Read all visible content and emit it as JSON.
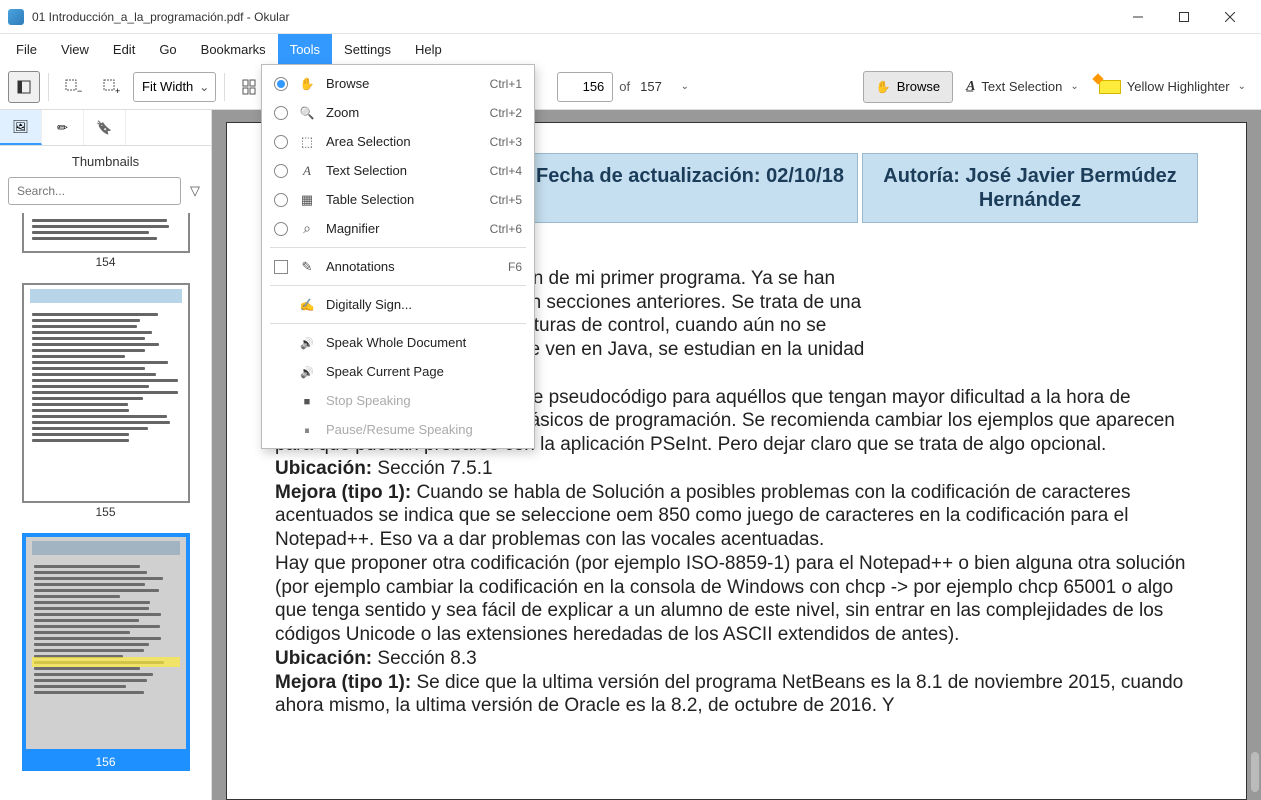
{
  "window": {
    "title": "01 Introducción_a_la_programación.pdf - Okular"
  },
  "menubar": {
    "items": [
      "File",
      "View",
      "Edit",
      "Go",
      "Bookmarks",
      "Tools",
      "Settings",
      "Help"
    ],
    "active_index": 5
  },
  "tools_menu": {
    "items": [
      {
        "type": "radio",
        "checked": true,
        "icon": "hand",
        "label": "Browse",
        "shortcut": "Ctrl+1"
      },
      {
        "type": "radio",
        "checked": false,
        "icon": "zoom",
        "label": "Zoom",
        "shortcut": "Ctrl+2"
      },
      {
        "type": "radio",
        "checked": false,
        "icon": "area",
        "label": "Area Selection",
        "shortcut": "Ctrl+3"
      },
      {
        "type": "radio",
        "checked": false,
        "icon": "textsel",
        "label": "Text Selection",
        "shortcut": "Ctrl+4"
      },
      {
        "type": "radio",
        "checked": false,
        "icon": "table",
        "label": "Table Selection",
        "shortcut": "Ctrl+5"
      },
      {
        "type": "radio",
        "checked": false,
        "icon": "mag",
        "label": "Magnifier",
        "shortcut": "Ctrl+6"
      },
      {
        "type": "sep"
      },
      {
        "type": "check",
        "checked": false,
        "icon": "pen",
        "label": "Annotations",
        "shortcut": "F6"
      },
      {
        "type": "sep"
      },
      {
        "type": "item",
        "icon": "sign",
        "label": "Digitally Sign...",
        "shortcut": ""
      },
      {
        "type": "sep"
      },
      {
        "type": "item",
        "icon": "speak",
        "label": "Speak Whole Document",
        "shortcut": ""
      },
      {
        "type": "item",
        "icon": "speak",
        "label": "Speak Current Page",
        "shortcut": ""
      },
      {
        "type": "item",
        "disabled": true,
        "icon": "stop",
        "label": "Stop Speaking",
        "shortcut": ""
      },
      {
        "type": "item",
        "disabled": true,
        "icon": "pause",
        "label": "Pause/Resume Speaking",
        "shortcut": ""
      }
    ]
  },
  "toolbar": {
    "zoom_mode": "Fit Width",
    "page_current": "156",
    "page_of": "of",
    "page_total": "157",
    "browse_label": "Browse",
    "text_selection_label": "Text Selection",
    "highlighter_label": "Yellow Highlighter"
  },
  "sidebar": {
    "title": "Thumbnails",
    "search_placeholder": "Search...",
    "thumbs": [
      {
        "page": "154",
        "selected": false,
        "partial": true
      },
      {
        "page": "155",
        "selected": false
      },
      {
        "page": "156",
        "selected": true
      }
    ]
  },
  "document": {
    "header": {
      "cell1": "",
      "cell2": "Fecha de actualización: 02/10/18",
      "cell3": "Autoría: José Javier Bermúdez Hernández"
    },
    "body_html": "eación de mi primer programa<br>ad no es exactamente Creación de mi primer programa. Ya se han<br>s de programas elementales en secciones anteriores. Se trata de una<br>digo que incluye incluso estructuras de control, cuando aún no se<br>s estructuras de control, que se ven en Java, se estudian en la unidad<br><br>ste apartado en un anexo sobre pseudocódigo para aquéllos que tengan mayor dificultad a la hora de entender algunos conceptos básicos de programación. Se recomienda cambiar los ejemplos que aparecen para que puedan probarse con la aplicación PSeInt. Pero dejar claro que se trata de algo opcional.<br><span class=\"bold\">Ubicación:</span> Sección 7.5.1<br><span class=\"bold\">Mejora (tipo 1):</span> Cuando se habla de Solución a posibles problemas con la codificación de caracteres acentuados se indica que se seleccione oem 850 como juego de caracteres en la codificación para el Notepad++. Eso va a dar problemas con las vocales acentuadas.<br>Hay que proponer otra codificación (por ejemplo ISO-8859-1) para el Notepad++ o bien alguna otra solución (por ejemplo cambiar la codificación en la consola de Windows con chcp -> por ejemplo chcp 65001 o algo que tenga sentido y sea fácil de explicar a un alumno de este nivel, sin entrar en las complejidades de los códigos Unicode o las extensiones heredadas de los ASCII extendidos de antes).<br><span class=\"bold\">Ubicación:</span> Sección 8.3<br><span class=\"bold\">Mejora (tipo 1):</span> Se dice que la ultima versión del programa NetBeans es la 8.1 de noviembre 2015, cuando ahora mismo, la ultima versión de Oracle es la 8.2, de octubre de 2016. Y"
  }
}
